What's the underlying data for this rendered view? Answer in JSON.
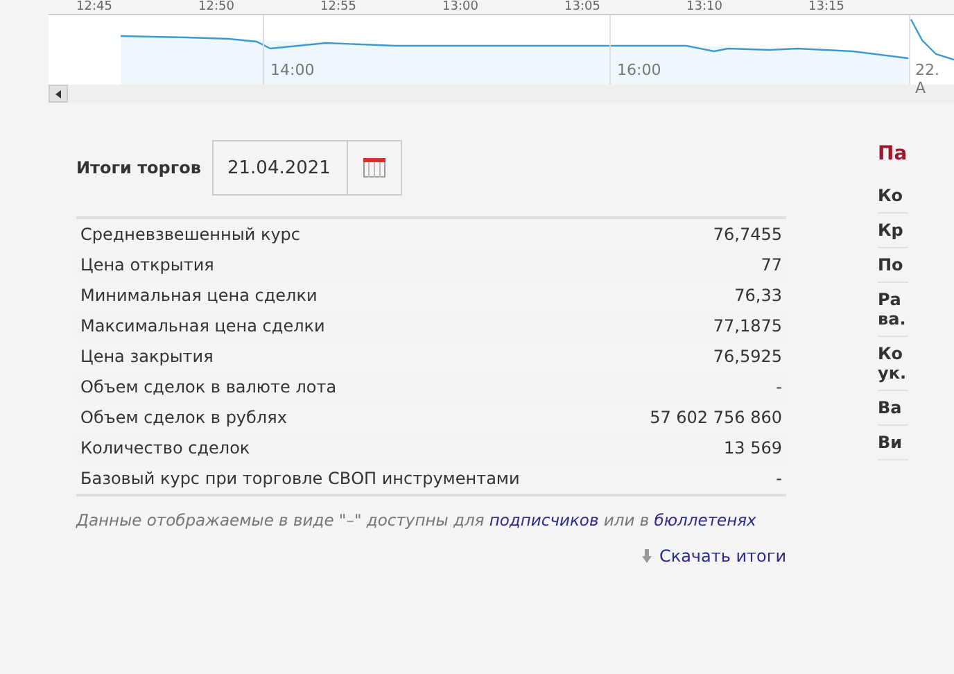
{
  "chart_navigator": {
    "top_axis_labels": [
      "12:45",
      "12:50",
      "12:55",
      "13:00",
      "13:05",
      "13:10",
      "13:15"
    ],
    "bottom_axis_labels": [
      "14:00",
      "16:00",
      "22. A"
    ]
  },
  "results": {
    "title": "Итоги торгов",
    "date": "21.04.2021",
    "rows": [
      {
        "label": "Средневзвешенный курс",
        "value": "76,7455"
      },
      {
        "label": "Цена открытия",
        "value": "77"
      },
      {
        "label": "Минимальная цена сделки",
        "value": "76,33"
      },
      {
        "label": "Максимальная цена сделки",
        "value": "77,1875"
      },
      {
        "label": "Цена закрытия",
        "value": "76,5925"
      },
      {
        "label": "Объем сделок в валюте лота",
        "value": "-"
      },
      {
        "label": "Объем сделок в рублях",
        "value": "57 602 756 860"
      },
      {
        "label": "Количество сделок",
        "value": "13 569"
      },
      {
        "label": "Базовый курс при торговле СВОП инструментами",
        "value": "-"
      }
    ],
    "note_text": "Данные отображаемые в виде \"–\" доступны для",
    "note_link_1": "подписчиков",
    "note_mid": "или в",
    "note_link_2": "бюллетенях",
    "download_link": "Скачать итоги"
  },
  "side_panel": {
    "title": "Па",
    "items": [
      "Ко",
      "Кр",
      "По",
      "Ра ва.",
      "Ко ук.",
      "Ва",
      "Ви"
    ]
  }
}
